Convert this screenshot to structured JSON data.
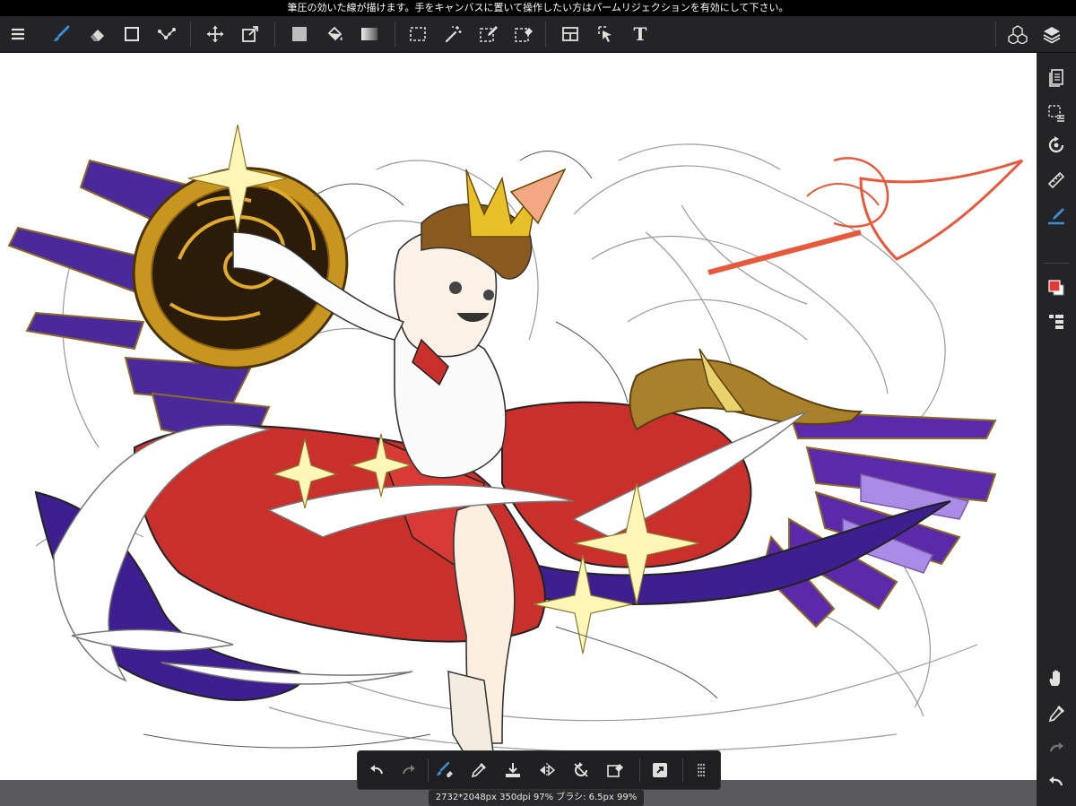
{
  "notice": "筆圧の効いた線が描けます。手をキャンバスに置いて操作したい方はパームリジェクションを有効にして下さい。",
  "toolbar": {
    "items": [
      "menu-icon",
      "brush-icon",
      "eraser-icon",
      "shape-rectangle-icon",
      "dot-brush-icon",
      "move-icon",
      "transform-icon",
      "fill-color-swatch-icon",
      "bucket-icon",
      "gradient-icon",
      "rect-select-icon",
      "magic-wand-icon",
      "select-pen-icon",
      "select-eraser-icon",
      "layout-icon",
      "object-select-icon",
      "text-tool-icon",
      "3d-material-icon",
      "layers-icon"
    ],
    "text_tool": "T"
  },
  "sidebar": {
    "items": [
      "page-manager-icon",
      "selection-mode-icon",
      "rotate-icon",
      "ruler-icon",
      "snap-pen-icon",
      "color-swatch-icon",
      "layer-list-icon",
      "hand-icon",
      "eyedropper-icon",
      "redo-icon",
      "undo-icon"
    ]
  },
  "quickbar": {
    "items": [
      "undo-icon",
      "redo-icon",
      "brush-eraser-toggle-icon",
      "eyedropper-icon",
      "save-icon",
      "flip-horizontal-icon",
      "reset-rotation-icon",
      "clear-layer-icon",
      "fullscreen-icon",
      "grid-dots-icon"
    ]
  },
  "status": "2732*2048px 350dpi 97% ブラシ: 6.5px 99%",
  "colors": {
    "primary": "#e53935",
    "secondary": "#ffffff",
    "accent": "#3a8fd6",
    "panel": "#242426",
    "canvas": "#ffffff"
  }
}
